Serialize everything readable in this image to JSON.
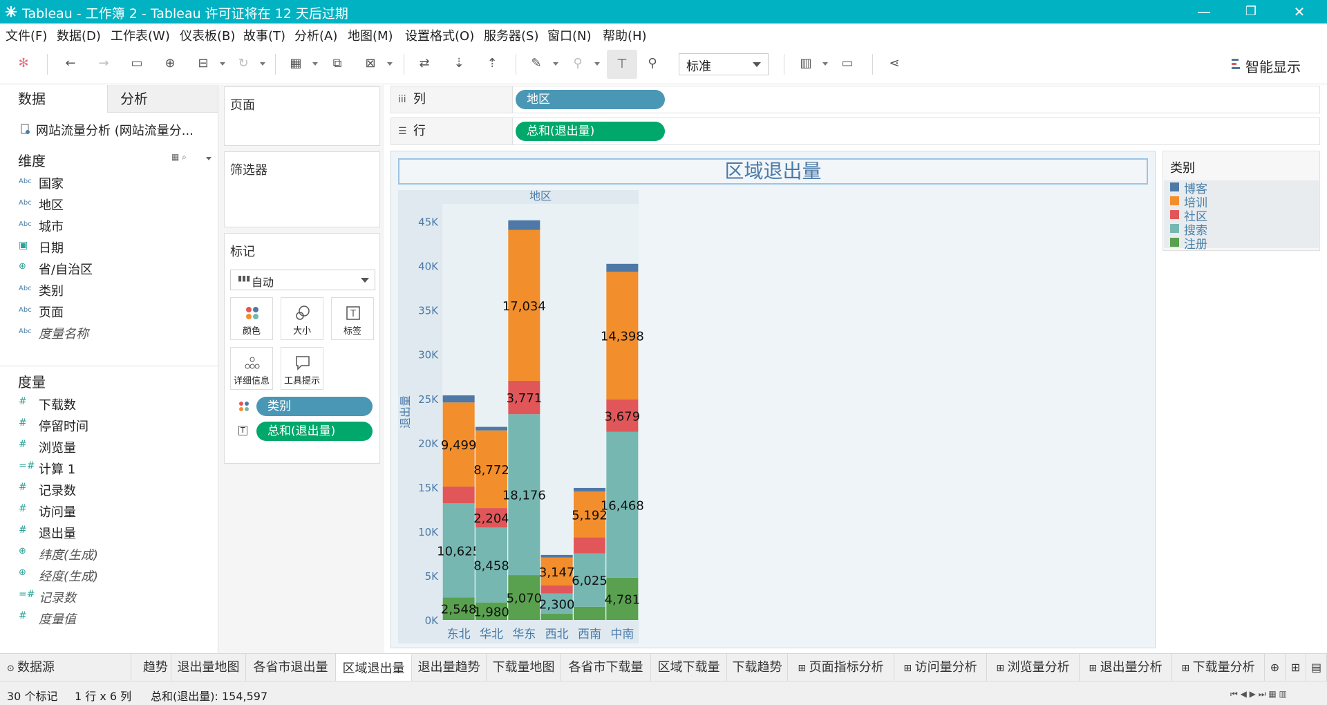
{
  "window": {
    "title": "Tableau - 工作簿 2 - Tableau 许可证将在 12 天后过期"
  },
  "menu": [
    "文件(F)",
    "数据(D)",
    "工作表(W)",
    "仪表板(B)",
    "故事(T)",
    "分析(A)",
    "地图(M)",
    "设置格式(O)",
    "服务器(S)",
    "窗口(N)",
    "帮助(H)"
  ],
  "toolbar": {
    "fit": "标准",
    "smart_show": "智能显示"
  },
  "left": {
    "tab_data": "数据",
    "tab_analysis": "分析",
    "datasource": "网站流量分析 (网站流量分...",
    "dimensions_title": "维度",
    "dimensions": [
      "国家",
      "地区",
      "城市",
      "日期",
      "省/自治区",
      "类别",
      "页面",
      "度量名称"
    ],
    "measures_title": "度量",
    "measures": [
      "下载数",
      "停留时间",
      "浏览量",
      "计算 1",
      "记录数",
      "访问量",
      "退出量",
      "纬度(生成)",
      "经度(生成)",
      "记录数",
      "度量值"
    ]
  },
  "cards": {
    "pages": "页面",
    "filters": "筛选器",
    "marks": "标记",
    "mark_type": "自动",
    "buttons": [
      "颜色",
      "大小",
      "标签",
      "详细信息",
      "工具提示"
    ],
    "pill_color": "类别",
    "pill_label": "总和(退出量)"
  },
  "shelves": {
    "columns_label": "列",
    "columns_pill": "地区",
    "rows_label": "行",
    "rows_pill": "总和(退出量)"
  },
  "legend": {
    "title": "类别",
    "items": [
      {
        "name": "博客",
        "color": "#4e79a7"
      },
      {
        "name": "培训",
        "color": "#f28e2b"
      },
      {
        "name": "社区",
        "color": "#e15759"
      },
      {
        "name": "搜索",
        "color": "#76b7b2"
      },
      {
        "name": "注册",
        "color": "#59a14f"
      }
    ]
  },
  "chart_data": {
    "type": "bar",
    "title": "区域退出量",
    "xlabel": "地区",
    "ylabel": "退出量",
    "ylim": [
      0,
      47000
    ],
    "yticks": [
      "0K",
      "5K",
      "10K",
      "15K",
      "20K",
      "25K",
      "30K",
      "35K",
      "40K",
      "45K"
    ],
    "categories": [
      "东北",
      "华北",
      "华东",
      "西北",
      "西南",
      "中南"
    ],
    "stacked": true,
    "series": [
      {
        "name": "注册",
        "values": [
          2548,
          1980,
          5070,
          700,
          1500,
          4781
        ],
        "labels": [
          "2,548",
          "1,980",
          "5,070",
          "",
          "",
          "4,781"
        ]
      },
      {
        "name": "搜索",
        "values": [
          10625,
          8458,
          18176,
          2300,
          6025,
          16468
        ],
        "labels": [
          "10,625",
          "8,458",
          "18,176",
          "2,300",
          "6,025",
          "16,468"
        ]
      },
      {
        "name": "社区",
        "values": [
          1900,
          2204,
          3771,
          900,
          1800,
          3679
        ],
        "labels": [
          "",
          "2,204",
          "3,771",
          "",
          "",
          "3,679"
        ]
      },
      {
        "name": "培训",
        "values": [
          9499,
          8772,
          17034,
          3147,
          5192,
          14398
        ],
        "labels": [
          "9,499",
          "8,772",
          "17,034",
          "3,147",
          "5,192",
          "14,398"
        ]
      },
      {
        "name": "博客",
        "values": [
          800,
          400,
          1100,
          300,
          400,
          900
        ],
        "labels": [
          "",
          "",
          "",
          "",
          "",
          ""
        ]
      }
    ]
  },
  "sheet_tabs": [
    "数据源",
    "趋势",
    "退出量地图",
    "各省市退出量",
    "区域退出量",
    "退出量趋势",
    "下载量地图",
    "各省市下载量",
    "区域下载量",
    "下载趋势",
    "页面指标分析",
    "访问量分析",
    "浏览量分析",
    "退出量分析",
    "下载量分析"
  ],
  "status": {
    "marks": "30 个标记",
    "dims": "1 行 x 6 列",
    "sum": "总和(退出量): 154,597"
  }
}
